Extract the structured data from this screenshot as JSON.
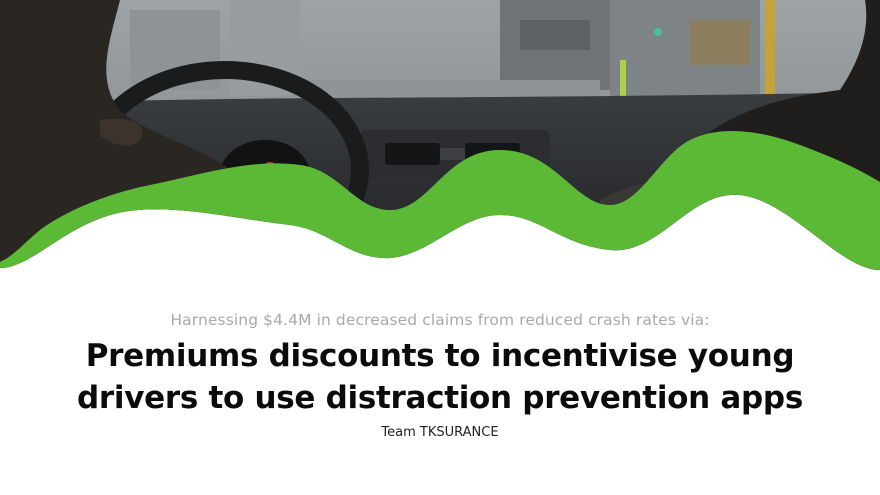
{
  "slide": {
    "subtitle": "Harnessing $4.4M in decreased claims from reduced crash rates via:",
    "title_line_1": "Premiums discounts to incentivise young",
    "title_line_2": "drivers to use distraction prevention apps",
    "team": "Team TKSURANCE"
  },
  "colors": {
    "accent_green": "#5cb936",
    "title_text": "#0b0b0b",
    "subtitle_text": "#a9a9a9"
  },
  "icons": {
    "hero_image": "car-interior-photo",
    "wave": "green-wave-divider"
  }
}
